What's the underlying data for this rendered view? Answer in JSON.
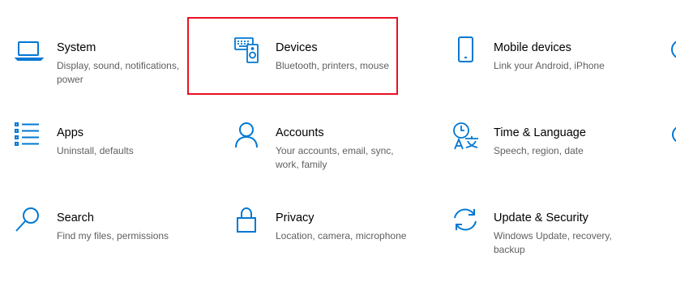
{
  "colors": {
    "accent": "#0078d4",
    "title": "#000000",
    "description": "#5f5f5f",
    "highlight_border": "#e81123"
  },
  "tiles": [
    {
      "title": "System",
      "desc": "Display, sound, notifications, power",
      "icon": "laptop-icon"
    },
    {
      "title": "Devices",
      "desc": "Bluetooth, printers, mouse",
      "icon": "devices-icon"
    },
    {
      "title": "Mobile devices",
      "desc": "Link your Android, iPhone",
      "icon": "phone-icon"
    },
    {
      "title": "Apps",
      "desc": "Uninstall, defaults",
      "icon": "apps-list-icon"
    },
    {
      "title": "Accounts",
      "desc": "Your accounts, email, sync, work, family",
      "icon": "person-icon"
    },
    {
      "title": "Time & Language",
      "desc": "Speech, region, date",
      "icon": "time-language-icon"
    },
    {
      "title": "Search",
      "desc": "Find my files, permissions",
      "icon": "search-icon"
    },
    {
      "title": "Privacy",
      "desc": "Location, camera, microphone",
      "icon": "lock-icon"
    },
    {
      "title": "Update & Security",
      "desc": "Windows Update, recovery, backup",
      "icon": "update-icon"
    }
  ]
}
